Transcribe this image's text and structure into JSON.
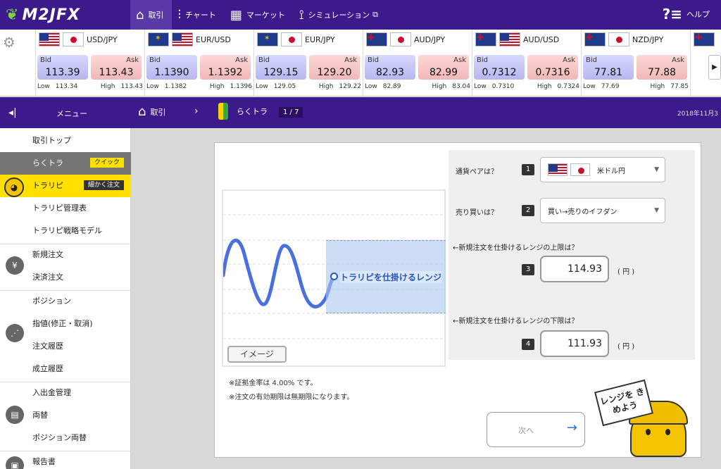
{
  "brand": {
    "logo_text": "M2JFX"
  },
  "topnav": {
    "items": [
      {
        "label": "取引"
      },
      {
        "label": "チャート"
      },
      {
        "label": "マーケット"
      },
      {
        "label": "シミュレーション"
      }
    ],
    "help_label": "ヘルプ"
  },
  "rates": [
    {
      "pair": "USD/JPY",
      "bid_label": "Bid",
      "ask_label": "Ask",
      "bid": "113.39",
      "ask": "113.43",
      "low_label": "Low",
      "low": "113.34",
      "high_label": "High",
      "high": "113.43"
    },
    {
      "pair": "EUR/USD",
      "bid_label": "Bid",
      "ask_label": "Ask",
      "bid": "1.1390",
      "ask": "1.1392",
      "low_label": "Low",
      "low": "1.1382",
      "high_label": "High",
      "high": "1.1396"
    },
    {
      "pair": "EUR/JPY",
      "bid_label": "Bid",
      "ask_label": "Ask",
      "bid": "129.15",
      "ask": "129.20",
      "low_label": "Low",
      "low": "129.05",
      "high_label": "High",
      "high": "129.22"
    },
    {
      "pair": "AUD/JPY",
      "bid_label": "Bid",
      "ask_label": "Ask",
      "bid": "82.93",
      "ask": "82.99",
      "low_label": "Low",
      "low": "82.89",
      "high_label": "High",
      "high": "83.04"
    },
    {
      "pair": "AUD/USD",
      "bid_label": "Bid",
      "ask_label": "Ask",
      "bid": "0.7312",
      "ask": "0.7316",
      "low_label": "Low",
      "low": "0.7310",
      "high_label": "High",
      "high": "0.7324"
    },
    {
      "pair": "NZD/JPY",
      "bid_label": "Bid",
      "ask_label": "Ask",
      "bid": "77.81",
      "ask": "77.88",
      "low_label": "Low",
      "low": "77.69",
      "high_label": "High",
      "high": "77.85"
    }
  ],
  "subbar": {
    "menu_label": "メニュー",
    "home_label": "取引",
    "current_label": "らくトラ",
    "step": "1 / 7",
    "date": "2018年11月3"
  },
  "sidebar": {
    "items": [
      {
        "label": "取引トップ"
      },
      {
        "label": "らくトラ",
        "badge": "クイック"
      },
      {
        "label": "トラリピ",
        "badge": "細かく注文"
      },
      {
        "label": "トラリピ管理表"
      },
      {
        "label": "トラリピ戦略モデル"
      },
      {
        "label": "新規注文"
      },
      {
        "label": "決済注文"
      },
      {
        "label": "ポジション"
      },
      {
        "label": "指値(修正・取消)"
      },
      {
        "label": "注文履歴"
      },
      {
        "label": "成立履歴"
      },
      {
        "label": "入出金管理"
      },
      {
        "label": "両替"
      },
      {
        "label": "ポジション両替"
      },
      {
        "label": "報告書"
      }
    ]
  },
  "main": {
    "zone_label": "トラリピを仕掛けるレンジ",
    "image_button": "イメージ",
    "notes": [
      "※証拠金率は 4.00% です。",
      "※注文の有効期限は無期限になります。"
    ],
    "form": {
      "q1": "通貨ペアは？",
      "n1": "1",
      "pair_value": "米ドル円",
      "q2": "売り買いは？",
      "n2": "2",
      "side_value": "買い→売りのイフダン",
      "q3": "←新規注文を仕掛けるレンジの上限は？",
      "n3": "3",
      "upper_value": "114.93",
      "unit": "( 円 )",
      "q4": "←新規注文を仕掛けるレンジの下限は？",
      "n4": "4",
      "lower_value": "111.93",
      "unit2": "( 円 )"
    },
    "next_label": "次へ",
    "mascot_sign": "レンジを きめよう"
  },
  "colors": {
    "nav": "#3c1a8c",
    "accent_yellow": "#ffe000",
    "wave": "#4a6fe0"
  }
}
